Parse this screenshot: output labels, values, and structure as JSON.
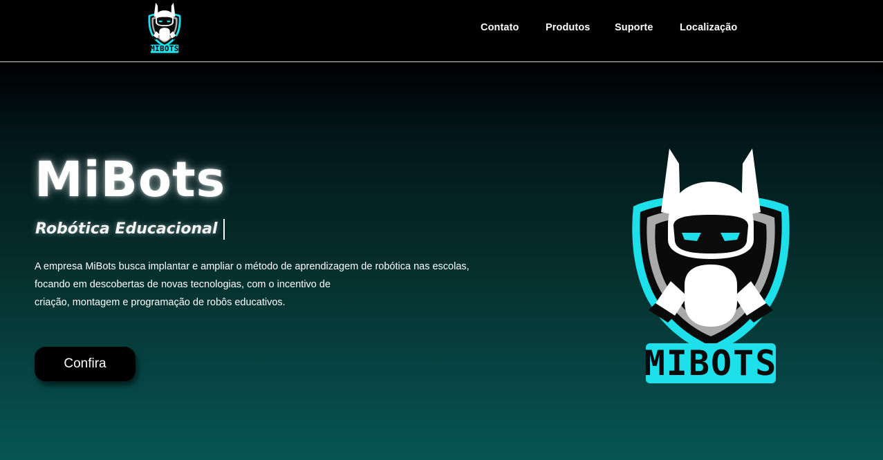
{
  "header": {
    "logo_icon": "mibots-robot-logo-icon",
    "nav": [
      {
        "label": "Contato"
      },
      {
        "label": "Produtos"
      },
      {
        "label": "Suporte"
      },
      {
        "label": "Localização"
      }
    ]
  },
  "hero": {
    "title": "MiBots",
    "subtitle": "Robótica Educacional",
    "description_lines": [
      "A empresa MiBots busca implantar e ampliar o método de aprendizagem de robótica nas escolas,",
      "focando em descobertas de novas tecnologias, com o incentivo de",
      "criação, montagem e programação de robôs educativos."
    ],
    "cta_label": "Confira",
    "logo_text": "MIBOTS",
    "logo_icon": "mibots-robot-logo-icon"
  },
  "colors": {
    "accent_cyan": "#1ee0ea",
    "background_top": "#000000",
    "background_bottom": "#065555",
    "button_bg": "#000000"
  }
}
